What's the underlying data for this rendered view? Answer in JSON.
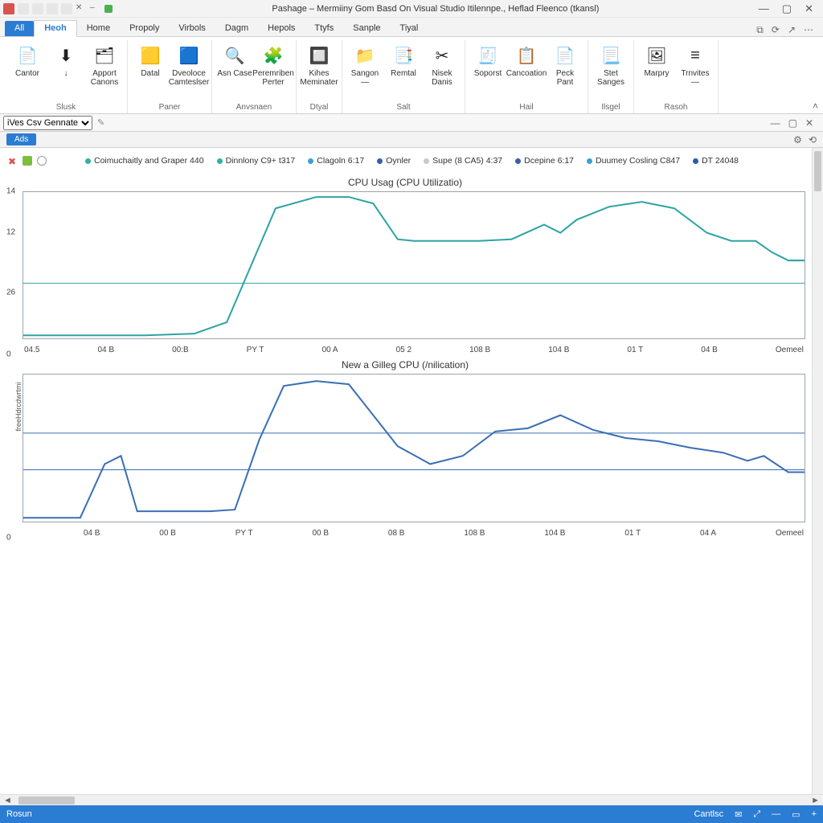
{
  "window": {
    "title": "Pashage – Mermiiny Gom Basd On Visual Studio Itilennpe., Heflad Fleenco (tkansl)"
  },
  "qat_icons": [
    "app",
    "save",
    "undo",
    "redo",
    "close",
    "x",
    "dash",
    "sq"
  ],
  "tabs": {
    "file": "All",
    "items": [
      "Heoh",
      "Home",
      "Propoly",
      "Virbols",
      "Dagm",
      "Hepols",
      "Ttyfs",
      "Sanple",
      "Tiyal"
    ],
    "active": 0
  },
  "ribbon": {
    "groups": [
      {
        "label": "Slusk",
        "buttons": [
          {
            "label": "Cantor",
            "icon": "📄"
          },
          {
            "label": "↓",
            "icon": "⬇"
          },
          {
            "label": "Apport Canons",
            "icon": "🗂"
          }
        ]
      },
      {
        "label": "Paner",
        "buttons": [
          {
            "label": "Datal",
            "icon": "🟨"
          },
          {
            "label": "Dveoloce Camteslser",
            "icon": "🟦"
          }
        ]
      },
      {
        "label": "Anvsnaen",
        "buttons": [
          {
            "label": "Asn Case",
            "icon": "🔍"
          },
          {
            "label": "Peremriben Perter",
            "icon": "🧩"
          }
        ]
      },
      {
        "label": "Dtyal",
        "buttons": [
          {
            "label": "Kihes Meminater",
            "icon": "🔲"
          }
        ]
      },
      {
        "label": "Salt",
        "buttons": [
          {
            "label": "Sangon —",
            "icon": "📁"
          },
          {
            "label": "Remtal",
            "icon": "📑"
          },
          {
            "label": "Nisek Danis",
            "icon": "✂"
          }
        ]
      },
      {
        "label": "Hail",
        "buttons": [
          {
            "label": "Soporst",
            "icon": "🧾"
          },
          {
            "label": "Cancoation",
            "icon": "📋"
          },
          {
            "label": "Peck Pant",
            "icon": "📄"
          }
        ]
      },
      {
        "label": "Ilsgel",
        "buttons": [
          {
            "label": "Stet Sanges",
            "icon": "📃"
          }
        ]
      },
      {
        "label": "Rasoh",
        "buttons": [
          {
            "label": "Marpry",
            "icon": "🖼"
          },
          {
            "label": "Trnvites —",
            "icon": "≡"
          }
        ]
      }
    ]
  },
  "secondbar": {
    "dropdown": "iVes Csv Gennate"
  },
  "paneltab": "Ads",
  "chart_header": {
    "legend": [
      {
        "color": "#2bb3a3",
        "label": "Coimuchaitly and Graper 440"
      },
      {
        "color": "#2bb3a3",
        "label": "Dinnlony C9+ t317"
      },
      {
        "color": "#3aa0d8",
        "label": "Clagoln 6:17"
      },
      {
        "color": "#3a5fa8",
        "label": "Oynler"
      },
      {
        "color": "#c9c9c9",
        "label": "Supe (8 CA5) 4:37"
      },
      {
        "color": "#3a5fa8",
        "label": "Dcepine 6:17"
      },
      {
        "color": "#3aa0d8",
        "label": "Duumey Cosling C847"
      },
      {
        "color": "#2b5aa8",
        "label": "DT 24048"
      }
    ]
  },
  "chart_data": [
    {
      "type": "line",
      "title": "CPU Usag (CPU Utilizatio)",
      "xlabel": "",
      "ylabel": "",
      "ylim": [
        0,
        14
      ],
      "yticks": [
        0,
        26,
        12,
        14
      ],
      "categories": [
        "04.5",
        "04 B",
        "00:B",
        "PY T",
        "00 A",
        "05 2",
        "108 B",
        "104 B",
        "01 T",
        "04 B",
        "Oemeel"
      ],
      "series": [
        {
          "name": "cpu",
          "color": "#2fa3a3",
          "values": [
            0.2,
            0.2,
            0.3,
            2.0,
            13.6,
            9.4,
            9.5,
            10.8,
            13.0,
            9.6,
            8.8
          ]
        }
      ]
    },
    {
      "type": "line",
      "title": "New a Gilleg CPU (/nilication)",
      "xlabel": "",
      "ylabel": "freeHdrcdwrtmi",
      "ylim": [
        0,
        100
      ],
      "categories": [
        "",
        "04 B",
        "00 B",
        "PY T",
        "00 B",
        "08 B",
        "108 B",
        "104 B",
        "01 T",
        "04 A",
        "Oemeel"
      ],
      "series": [
        {
          "name": "gilleg",
          "color": "#3a6fb5",
          "values": [
            2,
            4,
            25,
            30,
            95,
            50,
            62,
            70,
            55,
            50,
            45
          ]
        }
      ],
      "hlines": [
        35,
        60
      ]
    }
  ],
  "status": {
    "left": "Rosun",
    "right_items": [
      "Cantlsc",
      "✉",
      "⤢",
      "—",
      "▭",
      "+"
    ]
  }
}
